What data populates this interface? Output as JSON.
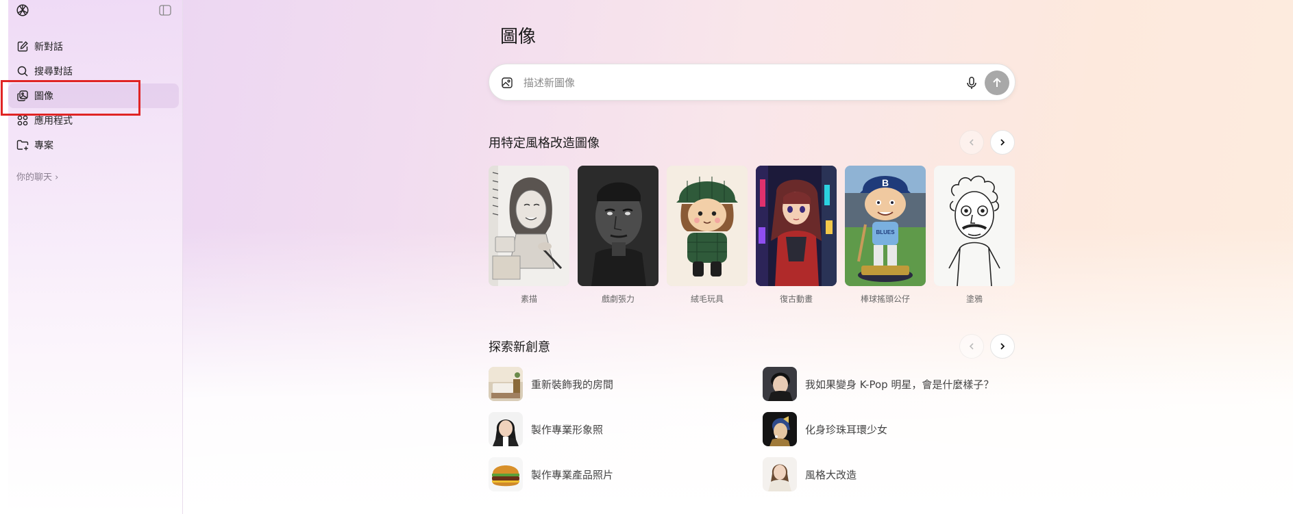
{
  "sidebar": {
    "logo_icon": "openai-logo-icon",
    "toggle_icon": "sidebar-toggle-icon",
    "items": [
      {
        "label": "新對話",
        "icon": "edit-icon"
      },
      {
        "label": "搜尋對話",
        "icon": "search-icon"
      },
      {
        "label": "圖像",
        "icon": "images-icon",
        "active": true
      },
      {
        "label": "應用程式",
        "icon": "apps-grid-icon"
      },
      {
        "label": "專案",
        "icon": "folder-plus-icon"
      }
    ],
    "your_chats": "你的聊天 ›"
  },
  "main": {
    "title": "圖像",
    "search": {
      "placeholder": "描述新圖像",
      "value": ""
    },
    "styles_section": {
      "title": "用特定風格改造圖像",
      "styles": [
        {
          "label": "素描"
        },
        {
          "label": "戲劇張力"
        },
        {
          "label": "絨毛玩具"
        },
        {
          "label": "復古動畫"
        },
        {
          "label": "棒球搖頭公仔"
        },
        {
          "label": "塗鴉"
        }
      ]
    },
    "ideas_section": {
      "title": "探索新創意",
      "items": [
        {
          "label": "重新裝飾我的房間"
        },
        {
          "label": "我如果變身 K-Pop 明星，會是什麼樣子？"
        },
        {
          "label": "製作專業形象照"
        },
        {
          "label": "化身珍珠耳環少女"
        },
        {
          "label": "製作專業產品照片"
        },
        {
          "label": "風格大改造"
        }
      ]
    }
  },
  "colors": {
    "highlight": "#e02424",
    "send_button": "#a8a8a8"
  }
}
